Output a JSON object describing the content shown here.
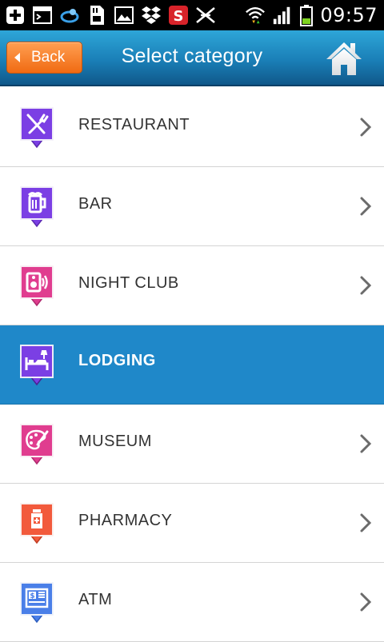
{
  "status_bar": {
    "time": "09:57",
    "icons": [
      "plus-icon",
      "terminal-icon",
      "swirl-app-icon",
      "sd-card-icon",
      "gallery-icon",
      "dropbox-icon",
      "app-s-icon",
      "network-icon",
      "wifi-icon",
      "signal-icon",
      "battery-icon"
    ]
  },
  "header": {
    "back_label": "Back",
    "title": "Select category",
    "home_icon": "home-icon"
  },
  "categories": [
    {
      "label": "RESTAURANT",
      "icon": "restaurant-icon",
      "color": "#7b3fe4",
      "selected": false
    },
    {
      "label": "BAR",
      "icon": "beer-icon",
      "color": "#7b3fe4",
      "selected": false
    },
    {
      "label": "NIGHT CLUB",
      "icon": "speaker-icon",
      "color": "#e03d8f",
      "selected": false
    },
    {
      "label": "LODGING",
      "icon": "bed-icon",
      "color": "#7b3fe4",
      "selected": true
    },
    {
      "label": "MUSEUM",
      "icon": "palette-icon",
      "color": "#e03d8f",
      "selected": false
    },
    {
      "label": "PHARMACY",
      "icon": "pill-bottle-icon",
      "color": "#f25a3c",
      "selected": false
    },
    {
      "label": "ATM",
      "icon": "atm-icon",
      "color": "#4a7fe8",
      "selected": false
    }
  ],
  "colors": {
    "header_blue": "#1a7fb7",
    "back_orange": "#f06a12",
    "selected_row": "#1f88c9"
  }
}
